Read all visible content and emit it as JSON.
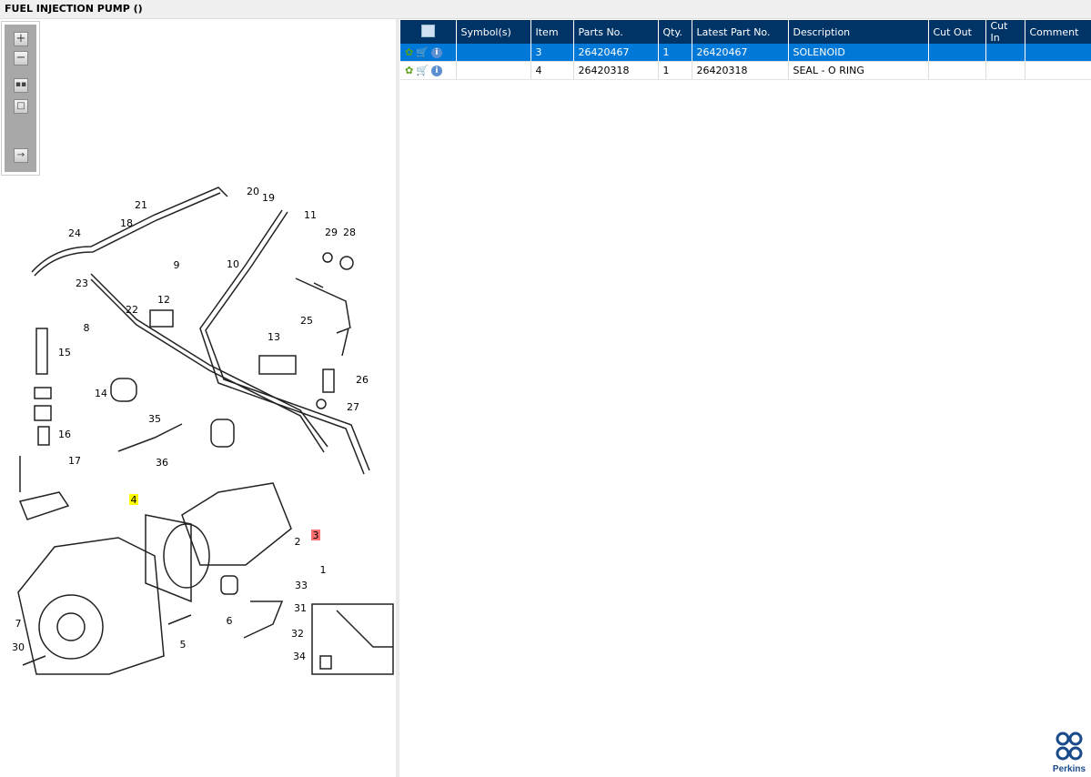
{
  "title": "FUEL INJECTION PUMP ()",
  "toolbar": {
    "icons": [
      "zoom-in-icon",
      "zoom-out-icon",
      "fit-all-icon",
      "actual-size-icon",
      "expand-panel-icon"
    ]
  },
  "diagram": {
    "callouts": [
      "21",
      "20",
      "19",
      "11",
      "18",
      "24",
      "29",
      "28",
      "9",
      "10",
      "23",
      "22",
      "12",
      "25",
      "8",
      "15",
      "13",
      "14",
      "26",
      "27",
      "35",
      "16",
      "36",
      "17",
      "4",
      "3",
      "2",
      "1",
      "33",
      "6",
      "31",
      "7",
      "5",
      "32",
      "30",
      "34"
    ],
    "highlight_colors": {
      "4": "#ffff00",
      "3": "#ff7070"
    }
  },
  "grid": {
    "columns": [
      "",
      "Symbol(s)",
      "Item",
      "Parts No.",
      "Qty.",
      "Latest Part No.",
      "Description",
      "Cut Out",
      "Cut In",
      "Comment"
    ],
    "rows": [
      {
        "symbols": "",
        "item": "3",
        "parts_no": "26420467",
        "qty": "1",
        "latest": "26420467",
        "description": "SOLENOID",
        "cut_out": "",
        "cut_in": "",
        "comment": "",
        "selected": true
      },
      {
        "symbols": "",
        "item": "4",
        "parts_no": "26420318",
        "qty": "1",
        "latest": "26420318",
        "description": "SEAL - O RING",
        "cut_out": "",
        "cut_in": "",
        "comment": "",
        "selected": false
      }
    ]
  },
  "colors": {
    "header": "#003366",
    "selected": "#0078d7"
  },
  "logo": {
    "text": "Perkins"
  }
}
